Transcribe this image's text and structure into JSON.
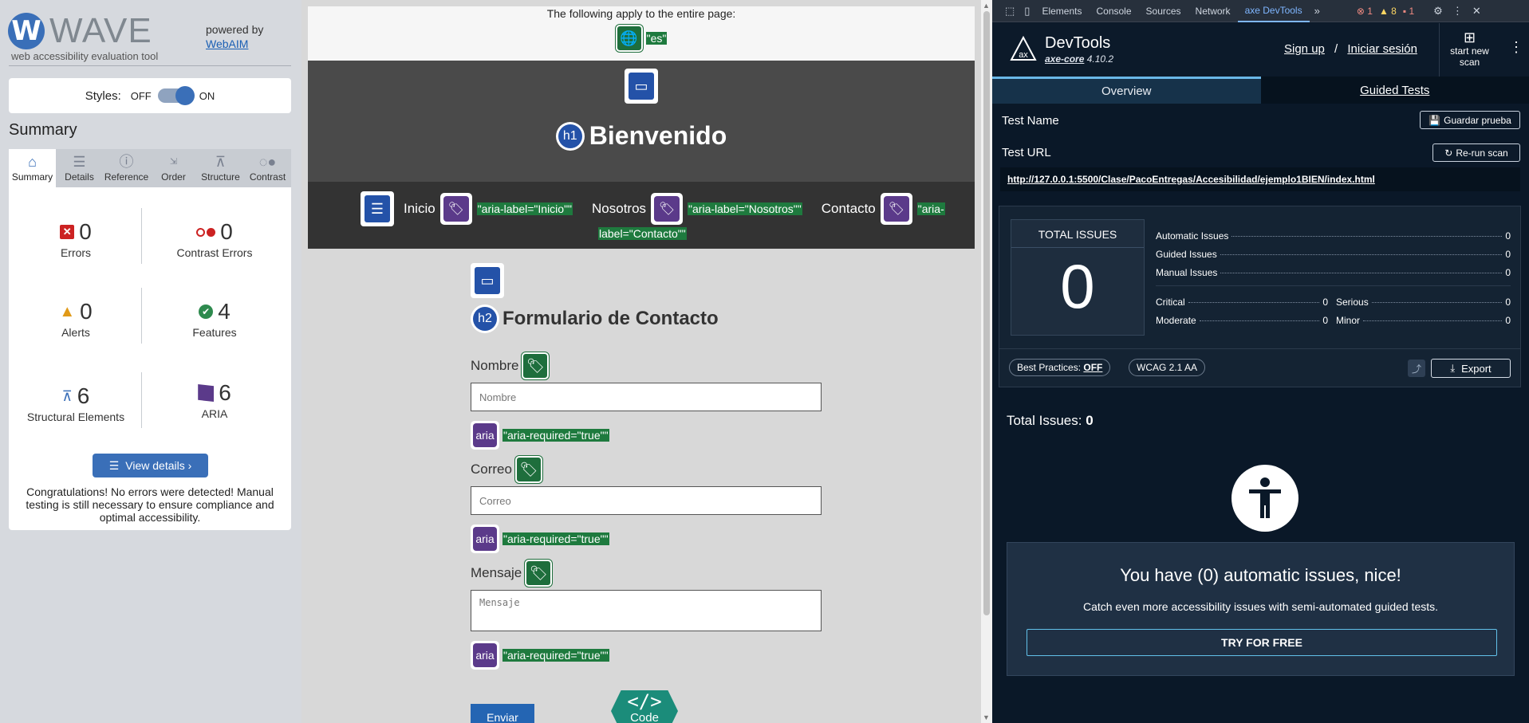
{
  "wave": {
    "logo_letter": "W",
    "logo_word": "WAVE",
    "tagline": "web accessibility evaluation tool",
    "powered_by": "powered by",
    "webaim": "WebAIM",
    "styles_label": "Styles:",
    "styles_off": "OFF",
    "styles_on": "ON",
    "summary_title": "Summary",
    "tabs": [
      {
        "label": "Summary",
        "icon": "home-icon"
      },
      {
        "label": "Details",
        "icon": "list-icon"
      },
      {
        "label": "Reference",
        "icon": "info-icon"
      },
      {
        "label": "Order",
        "icon": "order-icon"
      },
      {
        "label": "Structure",
        "icon": "structure-icon"
      },
      {
        "label": "Contrast",
        "icon": "contrast-icon"
      }
    ],
    "stats": {
      "errors": {
        "count": "0",
        "label": "Errors"
      },
      "contrast_errors": {
        "count": "0",
        "label": "Contrast Errors"
      },
      "alerts": {
        "count": "0",
        "label": "Alerts"
      },
      "features": {
        "count": "4",
        "label": "Features"
      },
      "structural": {
        "count": "6",
        "label": "Structural Elements"
      },
      "aria": {
        "count": "6",
        "label": "ARIA"
      }
    },
    "view_details": "View details ›",
    "congrats": "Congratulations! No errors were detected! Manual testing is still necessary to ensure compliance and optimal accessibility."
  },
  "page": {
    "applies_text": "The following apply to the entire page:",
    "lang_value": "\"es\"",
    "h1_badge": "h1",
    "h1_text": "Bienvenido",
    "nav": [
      {
        "label": "Inicio",
        "aria": "\"aria-label=\"Inicio\"\""
      },
      {
        "label": "Nosotros",
        "aria": "\"aria-label=\"Nosotros\"\""
      },
      {
        "label": "Contacto",
        "aria": "\"aria-"
      }
    ],
    "nav_wrap": "label=\"Contacto\"\"",
    "h2_badge": "h2",
    "h2_text": "Formulario de Contacto",
    "fields": [
      {
        "label": "Nombre",
        "placeholder": "Nombre",
        "aria_badge": "aria",
        "aria_text": "\"aria-required=\"true\"\""
      },
      {
        "label": "Correo",
        "placeholder": "Correo",
        "aria_badge": "aria",
        "aria_text": "\"aria-required=\"true\"\""
      },
      {
        "label": "Mensaje",
        "placeholder": "Mensaje",
        "aria_badge": "aria",
        "aria_text": "\"aria-required=\"true\"\""
      }
    ],
    "submit": "Enviar",
    "code_symbol": "</>",
    "code_label": "Code"
  },
  "devtools": {
    "tabs": [
      "Elements",
      "Console",
      "Sources",
      "Network",
      "axe DevTools"
    ],
    "active_tab": "axe DevTools",
    "error_count": "1",
    "warning_count": "8",
    "issue_count": "1",
    "title": "DevTools",
    "core_name": "axe-core",
    "core_version": "4.10.2",
    "sign_up": "Sign up",
    "separator": "/",
    "login": "Iniciar sesión",
    "new_scan": "start new scan",
    "view_tabs": {
      "overview": "Overview",
      "guided": "Guided Tests"
    },
    "test_name_label": "Test Name",
    "save_test": "Guardar prueba",
    "test_url_label": "Test URL",
    "rerun": "Re-run scan",
    "url": "http://127.0.0.1:5500/Clase/PacoEntregas/Accesibilidad/ejemplo1BIEN/index.html",
    "total_issues_label": "TOTAL ISSUES",
    "total_issues_value": "0",
    "breakdown": [
      {
        "label": "Automatic Issues",
        "value": "0"
      },
      {
        "label": "Guided Issues",
        "value": "0"
      },
      {
        "label": "Manual Issues",
        "value": "0"
      }
    ],
    "severity": {
      "critical": {
        "label": "Critical",
        "value": "0"
      },
      "serious": {
        "label": "Serious",
        "value": "0"
      },
      "moderate": {
        "label": "Moderate",
        "value": "0"
      },
      "minor": {
        "label": "Minor",
        "value": "0"
      }
    },
    "best_practices_label": "Best Practices:",
    "best_practices_value": "OFF",
    "wcag": "WCAG 2.1 AA",
    "export": "Export",
    "total_issues_heading": "Total Issues:",
    "total_issues_heading_value": "0",
    "nice_heading": "You have (0) automatic issues, nice!",
    "nice_text": "Catch even more accessibility issues with semi-automated guided tests.",
    "try_free": "TRY FOR FREE"
  },
  "colors": {
    "wave_blue": "#3a6fb8",
    "feature_green": "#1e6e3c",
    "aria_purple": "#5b3a8a",
    "axe_bg": "#0a1828",
    "axe_accent": "#6ab7e7"
  }
}
